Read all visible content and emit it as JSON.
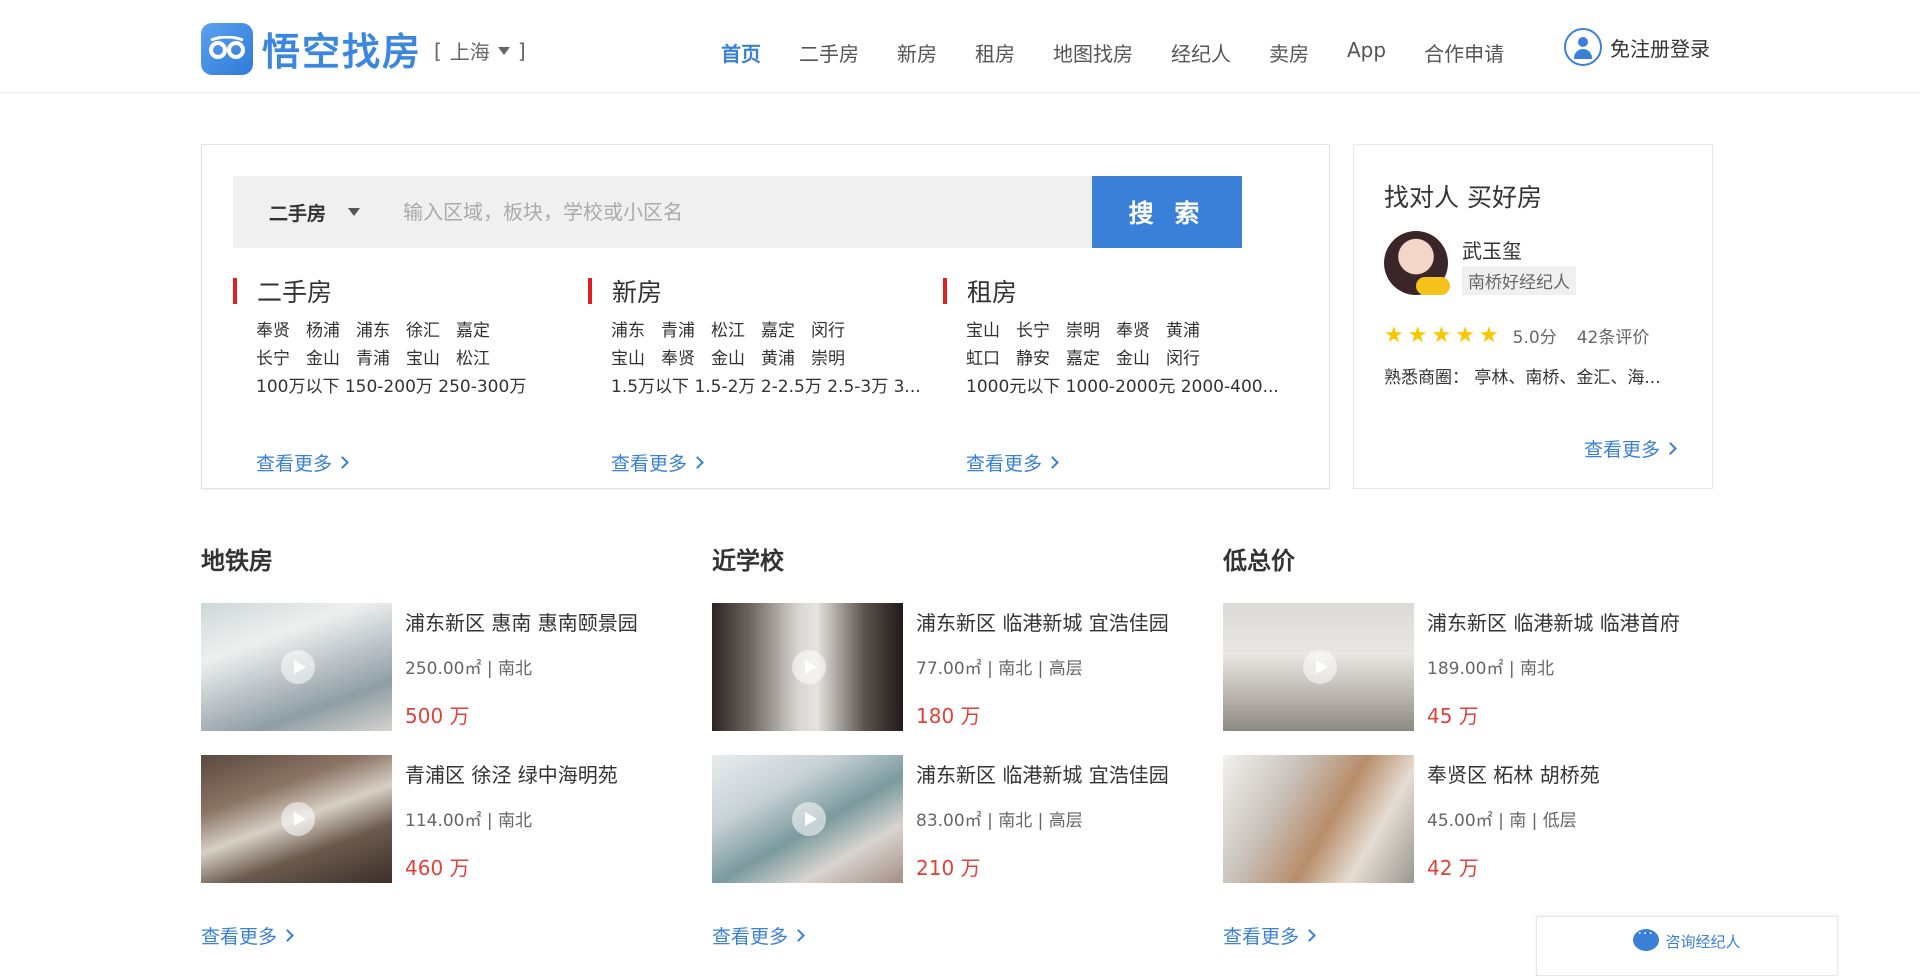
{
  "header": {
    "logo_text": "悟空找房",
    "city": "上海",
    "city_open": "[",
    "city_close": "]",
    "nav": [
      "首页",
      "二手房",
      "新房",
      "租房",
      "地图找房",
      "经纪人",
      "卖房",
      "App",
      "合作申请"
    ],
    "active_nav": "首页",
    "login": "免注册登录"
  },
  "search": {
    "type": "二手房",
    "placeholder": "输入区域，板块，学校或小区名",
    "button": "搜 索"
  },
  "categories": [
    {
      "title": "二手房",
      "districts_row1": [
        "奉贤",
        "杨浦",
        "浦东",
        "徐汇",
        "嘉定"
      ],
      "districts_row2": [
        "长宁",
        "金山",
        "青浦",
        "宝山",
        "松江"
      ],
      "prices": "100万以下 150-200万 250-300万",
      "more": "查看更多"
    },
    {
      "title": "新房",
      "districts_row1": [
        "浦东",
        "青浦",
        "松江",
        "嘉定",
        "闵行"
      ],
      "districts_row2": [
        "宝山",
        "奉贤",
        "金山",
        "黄浦",
        "崇明"
      ],
      "prices": "1.5万以下 1.5-2万 2-2.5万 2.5-3万 3...",
      "more": "查看更多"
    },
    {
      "title": "租房",
      "districts_row1": [
        "宝山",
        "长宁",
        "崇明",
        "奉贤",
        "黄浦"
      ],
      "districts_row2": [
        "虹口",
        "静安",
        "嘉定",
        "金山",
        "闵行"
      ],
      "prices": "1000元以下 1000-2000元 2000-400...",
      "more": "查看更多"
    }
  ],
  "agent": {
    "heading": "找对人 买好房",
    "name": "武玉玺",
    "tag": "南桥好经纪人",
    "rating": 5,
    "score": "5.0分",
    "reviews": "42条评价",
    "areas": "熟悉商圈：  亭林、南桥、金汇、海...",
    "more": "查看更多"
  },
  "sections": [
    {
      "title": "地铁房",
      "items": [
        {
          "title": "浦东新区 惠南 惠南颐景园",
          "meta": "250.00㎡  |  南北",
          "price": "500 万"
        },
        {
          "title": "青浦区 徐泾 绿中海明苑",
          "meta": "114.00㎡  |  南北",
          "price": "460 万"
        }
      ],
      "more": "查看更多"
    },
    {
      "title": "近学校",
      "items": [
        {
          "title": "浦东新区 临港新城 宜浩佳园",
          "meta": "77.00㎡  |  南北  |  高层",
          "price": "180 万"
        },
        {
          "title": "浦东新区 临港新城 宜浩佳园",
          "meta": "83.00㎡  |  南北  |  高层",
          "price": "210 万"
        }
      ],
      "more": "查看更多"
    },
    {
      "title": "低总价",
      "items": [
        {
          "title": "浦东新区 临港新城 临港首府",
          "meta": "189.00㎡  |  南北",
          "price": "45 万"
        },
        {
          "title": "奉贤区 柘林 胡桥苑",
          "meta": "45.00㎡  |  南  |  低层",
          "price": "42 万"
        }
      ],
      "more": "查看更多"
    }
  ],
  "consult": "咨询经纪人",
  "colors": {
    "accent": "#3b80d8",
    "price": "#e0413a",
    "category_bar": "#e02020",
    "star": "#f7c800"
  }
}
